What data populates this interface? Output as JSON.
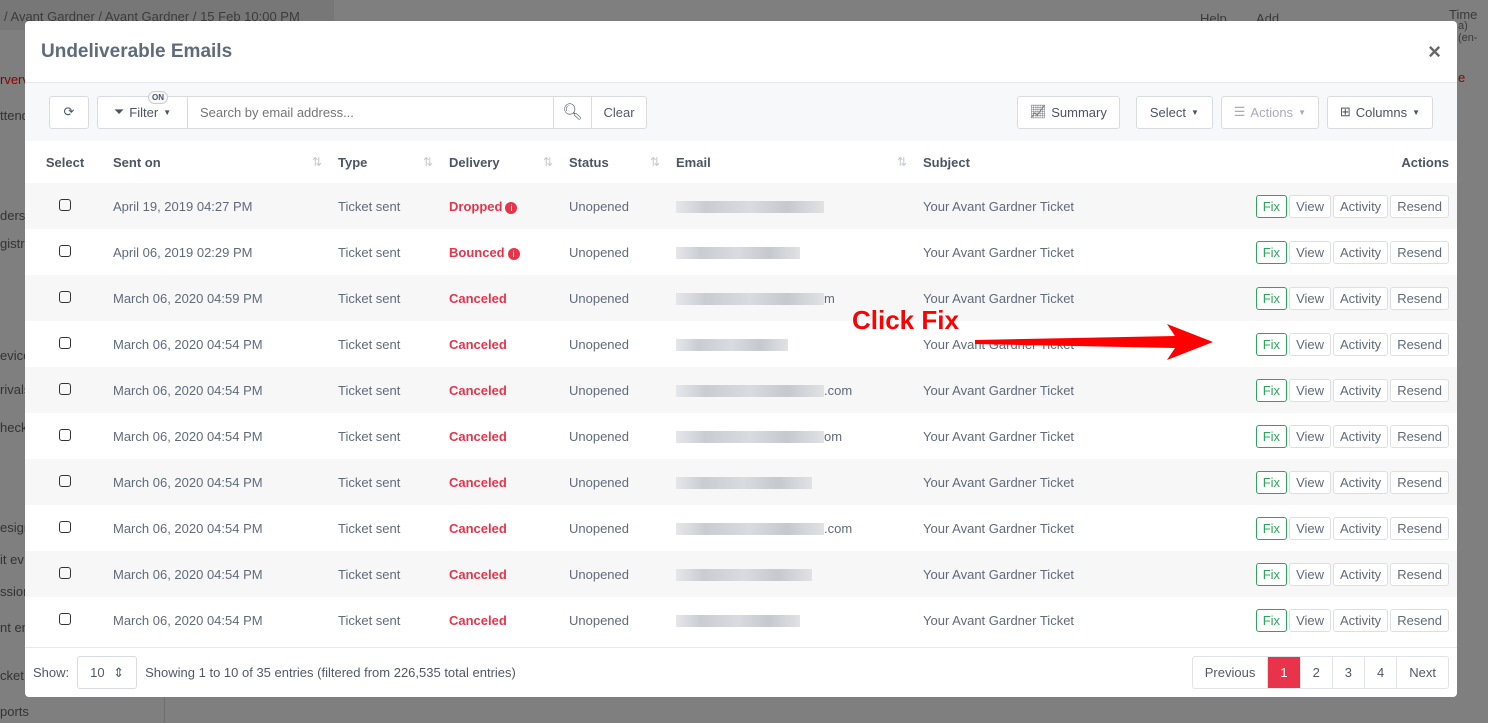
{
  "background": {
    "breadcrumb": "/   Avant Gardner  /   Avant Gardner  /  15 Feb 10:00 PM",
    "help": "Help",
    "add": "Add",
    "timezone": "Time Z",
    "timezone_sub": "a) (en-",
    "tab_fragment": "e",
    "sidebar": [
      "rvervie",
      "ttend",
      "ders",
      "gistr",
      "evice",
      "rivals",
      "heck",
      "esign",
      "it ev",
      "ssion",
      "nt em",
      "cket",
      "ports"
    ]
  },
  "modal": {
    "title": "Undeliverable Emails",
    "close": "×"
  },
  "toolbar": {
    "filter": "Filter",
    "filter_badge": "ON",
    "search_placeholder": "Search by email address...",
    "clear": "Clear",
    "summary": "Summary",
    "select": "Select",
    "actions": "Actions",
    "columns": "Columns"
  },
  "table": {
    "headers": [
      "Select",
      "Sent on",
      "Type",
      "Delivery",
      "Status",
      "Email",
      "Subject",
      "Actions"
    ],
    "action_labels": {
      "fix": "Fix",
      "view": "View",
      "activity": "Activity",
      "resend": "Resend"
    },
    "rows": [
      {
        "sent": "April 19, 2019 04:27 PM",
        "type": "Ticket sent",
        "delivery": "Dropped",
        "info": true,
        "status": "Unopened",
        "email_suffix": "",
        "subject": "Your Avant Gardner Ticket"
      },
      {
        "sent": "April 06, 2019 02:29 PM",
        "type": "Ticket sent",
        "delivery": "Bounced",
        "info": true,
        "status": "Unopened",
        "email_suffix": "",
        "subject": "Your Avant Gardner Ticket"
      },
      {
        "sent": "March 06, 2020 04:59 PM",
        "type": "Ticket sent",
        "delivery": "Canceled",
        "status": "Unopened",
        "email_suffix": "m",
        "subject": "Your Avant Gardner Ticket"
      },
      {
        "sent": "March 06, 2020 04:54 PM",
        "type": "Ticket sent",
        "delivery": "Canceled",
        "status": "Unopened",
        "email_suffix": "",
        "subject": "Your Avant Gardner Ticket"
      },
      {
        "sent": "March 06, 2020 04:54 PM",
        "type": "Ticket sent",
        "delivery": "Canceled",
        "status": "Unopened",
        "email_suffix": ".com",
        "subject": "Your Avant Gardner Ticket"
      },
      {
        "sent": "March 06, 2020 04:54 PM",
        "type": "Ticket sent",
        "delivery": "Canceled",
        "status": "Unopened",
        "email_suffix": "om",
        "subject": "Your Avant Gardner Ticket"
      },
      {
        "sent": "March 06, 2020 04:54 PM",
        "type": "Ticket sent",
        "delivery": "Canceled",
        "status": "Unopened",
        "email_suffix": "",
        "subject": "Your Avant Gardner Ticket"
      },
      {
        "sent": "March 06, 2020 04:54 PM",
        "type": "Ticket sent",
        "delivery": "Canceled",
        "status": "Unopened",
        "email_suffix": ".com",
        "subject": "Your Avant Gardner Ticket"
      },
      {
        "sent": "March 06, 2020 04:54 PM",
        "type": "Ticket sent",
        "delivery": "Canceled",
        "status": "Unopened",
        "email_suffix": "",
        "subject": "Your Avant Gardner Ticket"
      },
      {
        "sent": "March 06, 2020 04:54 PM",
        "type": "Ticket sent",
        "delivery": "Canceled",
        "status": "Unopened",
        "email_suffix": "",
        "subject": "Your Avant Gardner Ticket"
      }
    ]
  },
  "footer": {
    "show_label": "Show:",
    "page_size": "10",
    "info": "Showing 1 to 10 of 35 entries (filtered from 226,535 total entries)",
    "pages": [
      "Previous",
      "1",
      "2",
      "3",
      "4",
      "Next"
    ],
    "current_page": "1"
  },
  "annotation": {
    "text": "Click Fix",
    "color": "#ff0000"
  },
  "colors": {
    "danger": "#e8334a",
    "success": "#28a858"
  }
}
